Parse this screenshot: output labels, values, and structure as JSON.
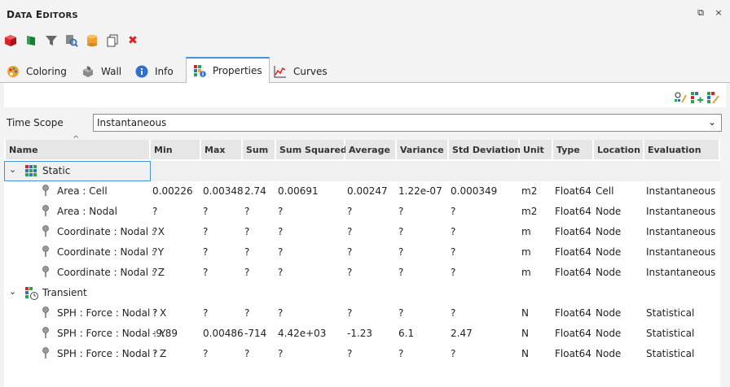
{
  "window": {
    "title_first": "D",
    "title_first_rest": "ATA",
    "title_second": "E",
    "title_second_rest": "DITORS",
    "restore_glyph": "⧉",
    "close_glyph": "×"
  },
  "toolbar": {
    "icons": [
      "red-cube-icon",
      "green-flag-icon",
      "filter-icon",
      "search-doc-icon",
      "database-icon",
      "copy-icon",
      "delete-icon"
    ],
    "delete_glyph": "✖"
  },
  "tabs": [
    {
      "label": "Coloring",
      "icon": "palette-icon",
      "active": false
    },
    {
      "label": "Wall",
      "icon": "wall-icon",
      "active": false
    },
    {
      "label": "Info",
      "icon": "info-icon",
      "active": false
    },
    {
      "label": "Properties",
      "icon": "properties-icon",
      "active": true
    },
    {
      "label": "Curves",
      "icon": "curves-icon",
      "active": false
    }
  ],
  "time_scope": {
    "label": "Time Scope",
    "value": "Instantaneous",
    "chevron": "⌄"
  },
  "columns": [
    "Name",
    "Min",
    "Max",
    "Sum",
    "Sum Squared",
    "Average",
    "Variance",
    "Std Deviation",
    "Unit",
    "Type",
    "Location",
    "Evaluation"
  ],
  "groups": [
    {
      "name": "Static",
      "expander": "⌄",
      "rows": [
        [
          "Area : Cell",
          "0.00226",
          "0.00348",
          "2.74",
          "0.00691",
          "0.00247",
          "1.22e-07",
          "0.000349",
          "m2",
          "Float64",
          "Cell",
          "Instantaneous"
        ],
        [
          "Area : Nodal",
          "?",
          "?",
          "?",
          "?",
          "?",
          "?",
          "?",
          "m2",
          "Float64",
          "Node",
          "Instantaneous"
        ],
        [
          "Coordinate : Nodal : X",
          "?",
          "?",
          "?",
          "?",
          "?",
          "?",
          "?",
          "m",
          "Float64",
          "Node",
          "Instantaneous"
        ],
        [
          "Coordinate : Nodal : Y",
          "?",
          "?",
          "?",
          "?",
          "?",
          "?",
          "?",
          "m",
          "Float64",
          "Node",
          "Instantaneous"
        ],
        [
          "Coordinate : Nodal : Z",
          "?",
          "?",
          "?",
          "?",
          "?",
          "?",
          "?",
          "m",
          "Float64",
          "Node",
          "Instantaneous"
        ]
      ]
    },
    {
      "name": "Transient",
      "expander": "⌄",
      "rows": [
        [
          "SPH : Force : Nodal : X",
          "?",
          "?",
          "?",
          "?",
          "?",
          "?",
          "?",
          "N",
          "Float64",
          "Node",
          "Statistical"
        ],
        [
          "SPH : Force : Nodal : Y",
          "-9.89",
          "0.00486",
          "-714",
          "4.42e+03",
          "-1.23",
          "6.1",
          "2.47",
          "N",
          "Float64",
          "Node",
          "Statistical"
        ],
        [
          "SPH : Force : Nodal : Z",
          "?",
          "?",
          "?",
          "?",
          "?",
          "?",
          "?",
          "N",
          "Float64",
          "Node",
          "Statistical"
        ]
      ]
    }
  ],
  "colors": {
    "accent": "#4a90d9",
    "header_bg": "#e6e6e6"
  }
}
